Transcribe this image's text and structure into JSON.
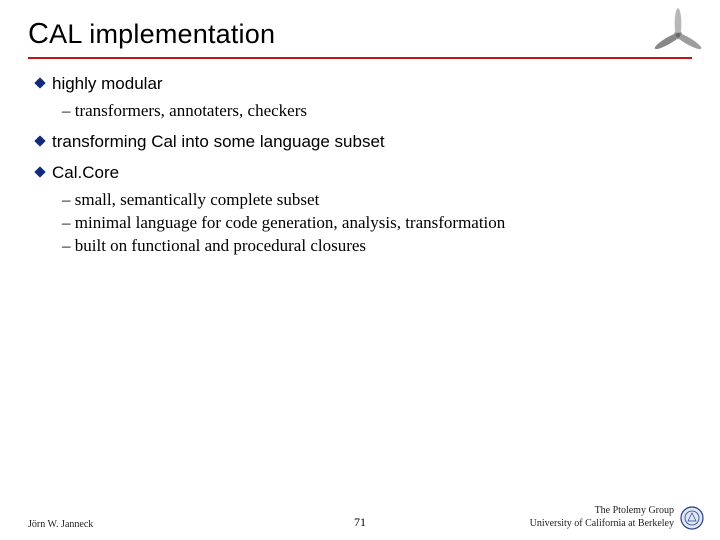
{
  "title": {
    "c": "C",
    "al": "AL",
    "rest": " implementation"
  },
  "bullets": [
    {
      "label": "highly modular",
      "subs": [
        "transformers, annotaters, checkers"
      ]
    },
    {
      "label": "transforming Cal into some language subset",
      "subs": []
    },
    {
      "label": "Cal.Core",
      "subs": [
        "small, semantically complete subset",
        "minimal language for code generation, analysis, transformation",
        "built on functional and procedural closures"
      ]
    }
  ],
  "footer": {
    "left": "Jörn W. Janneck",
    "page": "71",
    "right1": "The Ptolemy Group",
    "right2": "University of California at Berkeley"
  },
  "colors": {
    "rule": "#c01818",
    "diamond": "#122a7a"
  }
}
